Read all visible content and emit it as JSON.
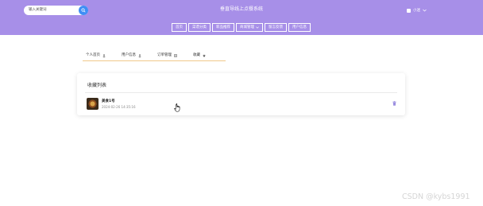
{
  "header": {
    "search": {
      "placeholder": "输入关键词",
      "value": ""
    },
    "app_title": "垂直导线上点餐系统",
    "user": {
      "name": "小迷",
      "menu_icon": "chevron-down-icon"
    },
    "accent_color": "#a78fe8"
  },
  "nav": {
    "items": [
      {
        "label": "首页"
      },
      {
        "label": "菜谱分类"
      },
      {
        "label": "新品推荐"
      },
      {
        "label": "商城管理",
        "has_dropdown": true
      },
      {
        "label": "留言反馈"
      },
      {
        "label": "用户信息"
      }
    ]
  },
  "tabs": [
    {
      "label": "个人首页",
      "icon": "user-icon"
    },
    {
      "label": "用户信息",
      "icon": "user-icon"
    },
    {
      "label": "订单管理",
      "icon": "order-icon"
    },
    {
      "label": "收藏",
      "icon": "star-icon"
    }
  ],
  "favorites": {
    "title": "收藏列表",
    "items": [
      {
        "name": "美食1号",
        "time": "2024-02-26 14:35:16"
      }
    ]
  },
  "watermark": "CSDN @kybs1991"
}
